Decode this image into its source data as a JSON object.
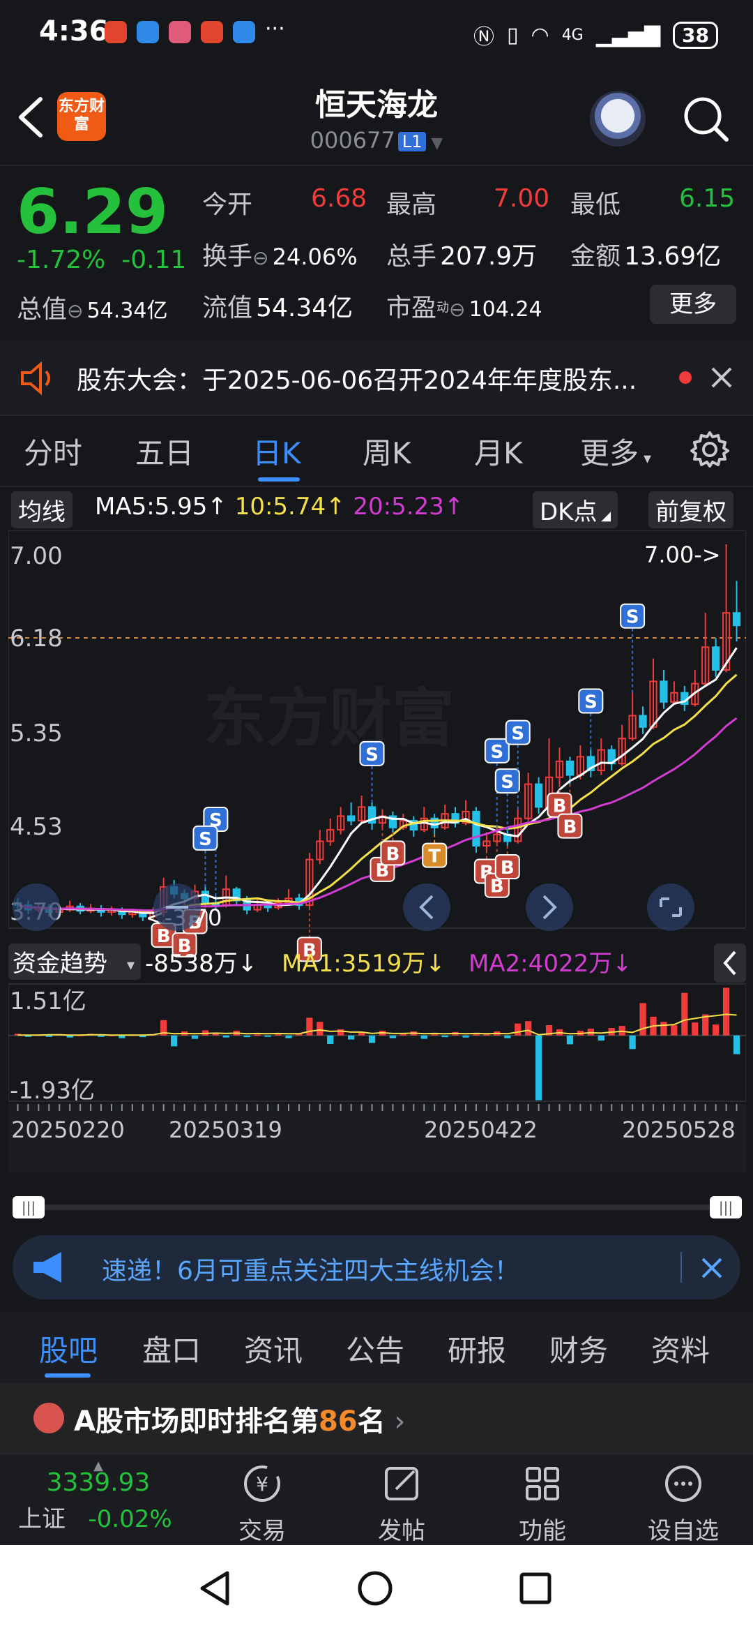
{
  "status_bar": {
    "time": "4:36",
    "network": "4G",
    "battery": "38"
  },
  "header": {
    "title": "恒天海龙",
    "code": "000677",
    "level_badge": "L1",
    "logo_text": "东方财富"
  },
  "quote": {
    "price": "6.29",
    "change_pct": "-1.72%",
    "change_abs": "-0.11",
    "open_label": "今开",
    "open": "6.68",
    "high_label": "最高",
    "high": "7.00",
    "low_label": "最低",
    "low": "6.15",
    "turnover_label": "换手",
    "turnover": "24.06%",
    "volume_label": "总手",
    "volume": "207.9万",
    "amount_label": "金额",
    "amount": "13.69亿",
    "mcap_label": "总值",
    "mcap": "54.34亿",
    "float_label": "流值",
    "float_value": "54.34亿",
    "pe_label": "市盈",
    "pe_sup": "动",
    "pe": "104.24",
    "more_label": "更多"
  },
  "notice": {
    "text": "股东大会：于2025-06-06召开2024年年度股东..."
  },
  "chart_tabs": [
    {
      "label": "分时"
    },
    {
      "label": "五日"
    },
    {
      "label": "日K"
    },
    {
      "label": "周K"
    },
    {
      "label": "月K"
    },
    {
      "label": "更多"
    }
  ],
  "ma_bar": {
    "mode_label": "均线",
    "ma5": "MA5:5.95↑",
    "ma10": "10:5.74↑",
    "ma20": "20:5.23↑",
    "dk_label": "DK点",
    "adjust_label": "前复权"
  },
  "fund_bar": {
    "label": "资金趋势",
    "value": "-8538万↓",
    "ma1": "MA1:3519万↓",
    "ma2": "MA2:4022万↓"
  },
  "colors": {
    "up": "#f23b3b",
    "down": "#25c0e8",
    "ma5": "#ffffff",
    "ma10": "#f5e04a",
    "ma20": "#d23cd2",
    "accent": "#3d8fff"
  },
  "chart_data": {
    "type": "candlestick",
    "price_axis_labels": [
      "7.00",
      "6.18",
      "5.35",
      "4.53",
      "3.70"
    ],
    "ylim": [
      3.7,
      7.0
    ],
    "reference_line": 6.18,
    "max_marker": "7.00->",
    "min_marker": "<-3.70",
    "fund_axis_labels": [
      "1.51亿",
      "-1.93亿"
    ],
    "fund_ylim": [
      -1.93,
      1.51
    ],
    "date_labels": [
      "20250220",
      "20250319",
      "20250422",
      "20250528"
    ],
    "candles": [
      [
        3.86,
        3.84,
        3.9,
        3.8
      ],
      [
        3.84,
        3.8,
        3.88,
        3.76
      ],
      [
        3.8,
        3.82,
        3.86,
        3.78
      ],
      [
        3.82,
        3.78,
        3.85,
        3.74
      ],
      [
        3.78,
        3.8,
        3.84,
        3.75
      ],
      [
        3.8,
        3.83,
        3.88,
        3.78
      ],
      [
        3.83,
        3.79,
        3.86,
        3.76
      ],
      [
        3.79,
        3.81,
        3.85,
        3.77
      ],
      [
        3.81,
        3.78,
        3.84,
        3.74
      ],
      [
        3.78,
        3.8,
        3.83,
        3.75
      ],
      [
        3.8,
        3.76,
        3.82,
        3.72
      ],
      [
        3.76,
        3.78,
        3.81,
        3.73
      ],
      [
        3.78,
        3.74,
        3.8,
        3.7
      ],
      [
        3.74,
        3.78,
        3.82,
        3.72
      ],
      [
        3.78,
        4.0,
        4.08,
        3.76
      ],
      [
        4.0,
        3.94,
        4.06,
        3.9
      ],
      [
        3.94,
        3.9,
        3.98,
        3.86
      ],
      [
        3.9,
        3.96,
        4.02,
        3.88
      ],
      [
        3.96,
        3.86,
        4.0,
        3.82
      ],
      [
        3.86,
        3.84,
        3.92,
        3.8
      ],
      [
        3.84,
        3.98,
        4.1,
        3.82
      ],
      [
        3.98,
        3.88,
        4.0,
        3.84
      ],
      [
        3.88,
        3.8,
        3.92,
        3.76
      ],
      [
        3.8,
        3.84,
        3.9,
        3.78
      ],
      [
        3.84,
        3.82,
        3.88,
        3.78
      ],
      [
        3.82,
        3.86,
        3.9,
        3.8
      ],
      [
        3.86,
        3.9,
        3.98,
        3.84
      ],
      [
        3.9,
        3.84,
        3.94,
        3.8
      ],
      [
        3.84,
        4.24,
        4.3,
        3.82
      ],
      [
        4.24,
        4.4,
        4.5,
        4.2
      ],
      [
        4.4,
        4.5,
        4.6,
        4.36
      ],
      [
        4.5,
        4.62,
        4.7,
        4.46
      ],
      [
        4.62,
        4.58,
        4.74,
        4.54
      ],
      [
        4.58,
        4.7,
        4.8,
        4.56
      ],
      [
        4.7,
        4.56,
        4.74,
        4.5
      ],
      [
        4.56,
        4.62,
        4.68,
        4.52
      ],
      [
        4.62,
        4.52,
        4.66,
        4.48
      ],
      [
        4.52,
        4.58,
        4.64,
        4.5
      ],
      [
        4.58,
        4.5,
        4.62,
        4.44
      ],
      [
        4.5,
        4.6,
        4.7,
        4.48
      ],
      [
        4.6,
        4.52,
        4.64,
        4.46
      ],
      [
        4.52,
        4.64,
        4.72,
        4.5
      ],
      [
        4.64,
        4.56,
        4.7,
        4.52
      ],
      [
        4.56,
        4.66,
        4.76,
        4.54
      ],
      [
        4.66,
        4.36,
        4.7,
        4.3
      ],
      [
        4.36,
        4.4,
        4.48,
        4.32
      ],
      [
        4.4,
        4.46,
        4.52,
        4.38
      ],
      [
        4.46,
        4.4,
        4.5,
        4.36
      ],
      [
        4.4,
        4.6,
        4.68,
        4.38
      ],
      [
        4.6,
        4.9,
        5.0,
        4.58
      ],
      [
        4.9,
        4.7,
        4.96,
        4.64
      ],
      [
        4.7,
        4.96,
        5.3,
        4.66
      ],
      [
        4.96,
        5.1,
        5.22,
        4.9
      ],
      [
        5.1,
        4.98,
        5.14,
        4.9
      ],
      [
        4.98,
        5.14,
        5.24,
        4.94
      ],
      [
        5.14,
        5.02,
        5.2,
        4.96
      ],
      [
        5.02,
        5.2,
        5.3,
        4.98
      ],
      [
        5.2,
        5.08,
        5.24,
        5.02
      ],
      [
        5.08,
        5.3,
        5.42,
        5.06
      ],
      [
        5.3,
        5.5,
        5.7,
        5.28
      ],
      [
        5.5,
        5.4,
        5.58,
        5.34
      ],
      [
        5.4,
        5.8,
        6.0,
        5.38
      ],
      [
        5.8,
        5.62,
        5.9,
        5.56
      ],
      [
        5.62,
        5.7,
        5.8,
        5.6
      ],
      [
        5.7,
        5.6,
        5.76,
        5.54
      ],
      [
        5.6,
        5.78,
        5.9,
        5.58
      ],
      [
        5.78,
        6.1,
        6.4,
        5.76
      ],
      [
        6.1,
        5.9,
        6.18,
        5.84
      ],
      [
        5.9,
        6.4,
        7.0,
        5.88
      ],
      [
        6.4,
        6.29,
        6.68,
        6.15
      ]
    ],
    "fund_bars": [
      0.05,
      -0.04,
      0.03,
      -0.02,
      0.04,
      -0.06,
      0.02,
      0.05,
      -0.03,
      0.02,
      -0.08,
      0.03,
      -0.05,
      0.04,
      0.45,
      -0.32,
      0.12,
      -0.1,
      0.15,
      0.08,
      -0.06,
      0.14,
      -0.05,
      0.03,
      -0.04,
      0.06,
      -0.08,
      0.05,
      0.52,
      0.4,
      -0.25,
      0.18,
      -0.12,
      0.1,
      -0.22,
      0.14,
      -0.08,
      0.06,
      0.12,
      -0.1,
      0.08,
      -0.05,
      0.1,
      -0.06,
      0.08,
      0.04,
      0.12,
      -0.08,
      0.35,
      0.42,
      -1.9,
      0.3,
      0.18,
      -0.26,
      0.14,
      0.2,
      -0.15,
      0.22,
      0.28,
      -0.4,
      0.95,
      0.55,
      0.4,
      0.3,
      1.25,
      0.38,
      0.62,
      0.32,
      1.4,
      -0.55
    ],
    "fund_ma1": [
      0.01,
      0.01,
      0.01,
      0.02,
      0.02,
      0.01,
      0.01,
      0.02,
      0.02,
      0.01,
      0.01,
      0.01,
      0.01,
      0.02,
      0.08,
      0.05,
      0.06,
      0.05,
      0.06,
      0.07,
      0.06,
      0.07,
      0.05,
      0.06,
      0.05,
      0.06,
      0.05,
      0.05,
      0.12,
      0.16,
      0.12,
      0.13,
      0.1,
      0.1,
      0.06,
      0.08,
      0.06,
      0.06,
      0.07,
      0.05,
      0.06,
      0.05,
      0.06,
      0.05,
      0.06,
      0.05,
      0.06,
      0.05,
      0.1,
      0.15,
      0.02,
      0.05,
      0.08,
      0.05,
      0.06,
      0.08,
      0.07,
      0.1,
      0.12,
      0.09,
      0.2,
      0.28,
      0.3,
      0.32,
      0.45,
      0.5,
      0.55,
      0.58,
      0.62,
      0.6
    ],
    "buy_sell_marks": [
      {
        "label": "B",
        "i": 14
      },
      {
        "label": "B",
        "i": 16
      },
      {
        "label": "B",
        "i": 17
      },
      {
        "label": "S",
        "i": 19
      },
      {
        "label": "S",
        "i": 18
      },
      {
        "label": "B",
        "i": 28
      },
      {
        "label": "S",
        "i": 34
      },
      {
        "label": "B",
        "i": 35
      },
      {
        "label": "B",
        "i": 36
      },
      {
        "label": "T",
        "i": 40
      },
      {
        "label": "B",
        "i": 45
      },
      {
        "label": "B",
        "i": 46
      },
      {
        "label": "B",
        "i": 47
      },
      {
        "label": "S",
        "i": 46
      },
      {
        "label": "S",
        "i": 47
      },
      {
        "label": "S",
        "i": 48
      },
      {
        "label": "B",
        "i": 52
      },
      {
        "label": "B",
        "i": 53
      },
      {
        "label": "S",
        "i": 55
      },
      {
        "label": "S",
        "i": 59
      }
    ]
  },
  "ad": {
    "text": "速递！6月可重点关注四大主线机会！"
  },
  "sections": [
    {
      "label": "股吧"
    },
    {
      "label": "盘口"
    },
    {
      "label": "资讯"
    },
    {
      "label": "公告"
    },
    {
      "label": "研报"
    },
    {
      "label": "财务"
    },
    {
      "label": "资料"
    }
  ],
  "rank": {
    "prefix": "A股市场即时排名第",
    "rank_number": "86",
    "suffix": "名"
  },
  "bottom_nav": {
    "index_value": "3339.93",
    "index_name": "上证",
    "index_change": "-0.02%",
    "items": [
      {
        "label": "交易"
      },
      {
        "label": "发帖"
      },
      {
        "label": "功能"
      },
      {
        "label": "设自选"
      }
    ]
  },
  "watermark": "东方财富"
}
